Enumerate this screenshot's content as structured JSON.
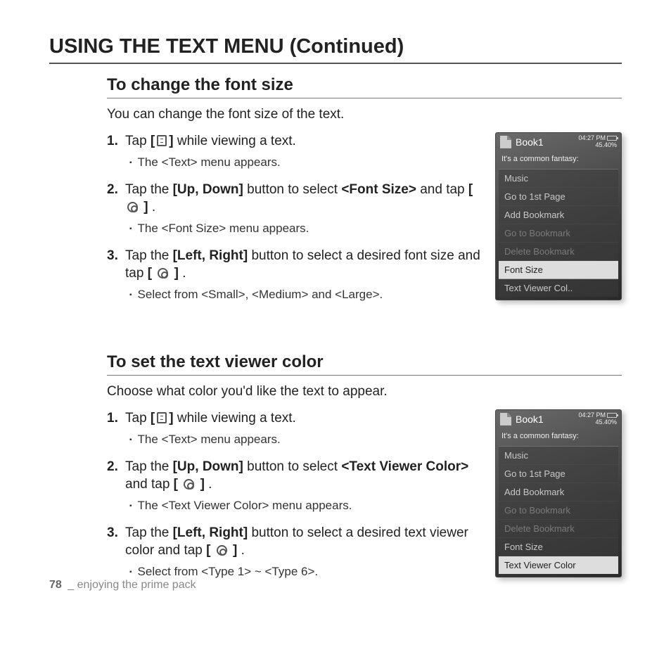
{
  "page_title": "USING THE TEXT MENU (Continued)",
  "footer": {
    "page_num": "78",
    "sep": "_",
    "chapter": "enjoying the prime pack"
  },
  "sectionA": {
    "title": "To change the font size",
    "intro": "You can change the font size of the text.",
    "steps": [
      {
        "num": "1.",
        "pre": "Tap ",
        "btn_open": "[",
        "icon": "menu",
        "btn_close": "]",
        "post": " while viewing a text.",
        "sub": [
          "The <Text> menu appears."
        ]
      },
      {
        "num": "2.",
        "line": "Tap the |[Up, Down]| button to select |<Font Size>| and tap |[| @circle |]|.",
        "sub": [
          "The <Font Size> menu appears."
        ]
      },
      {
        "num": "3.",
        "line": "Tap the |[Left, Right]| button to select a desired font size and tap |[| @circle |]|.",
        "sub": [
          "Select from <Small>, <Medium> and <Large>."
        ]
      }
    ]
  },
  "sectionB": {
    "title": "To set the text viewer color",
    "intro": "Choose what color you'd like the text to appear.",
    "steps": [
      {
        "num": "1.",
        "pre": "Tap ",
        "btn_open": "[",
        "icon": "menu",
        "btn_close": "]",
        "post": " while viewing a text.",
        "sub": [
          "The <Text> menu appears."
        ]
      },
      {
        "num": "2.",
        "line": "Tap the |[Up, Down]| button to select |<Text Viewer Color>| and tap |[| @circle |]|.",
        "sub": [
          "The <Text Viewer Color> menu appears."
        ]
      },
      {
        "num": "3.",
        "line": "Tap the |[Left, Right]| button to select a desired text viewer color and tap |[| @circle |]|.",
        "sub": [
          "Select from <Type 1> ~ <Type 6>."
        ]
      }
    ]
  },
  "device": {
    "book": "Book1",
    "time": "04:27 PM",
    "percent": "45.40%",
    "fantasy": "It's a common fantasy:",
    "menuA": [
      {
        "t": "Music",
        "c": ""
      },
      {
        "t": "Go to 1st Page",
        "c": ""
      },
      {
        "t": "Add Bookmark",
        "c": ""
      },
      {
        "t": "Go to Bookmark",
        "c": "dim"
      },
      {
        "t": "Delete Bookmark",
        "c": "dim"
      },
      {
        "t": "Font Size",
        "c": "sel"
      },
      {
        "t": "Text Viewer Col..",
        "c": ""
      }
    ],
    "menuB": [
      {
        "t": "Music",
        "c": ""
      },
      {
        "t": "Go to 1st Page",
        "c": ""
      },
      {
        "t": "Add Bookmark",
        "c": ""
      },
      {
        "t": "Go to Bookmark",
        "c": "dim"
      },
      {
        "t": "Delete Bookmark",
        "c": "dim"
      },
      {
        "t": "Font Size",
        "c": ""
      },
      {
        "t": "Text Viewer Color",
        "c": "sel"
      }
    ]
  }
}
